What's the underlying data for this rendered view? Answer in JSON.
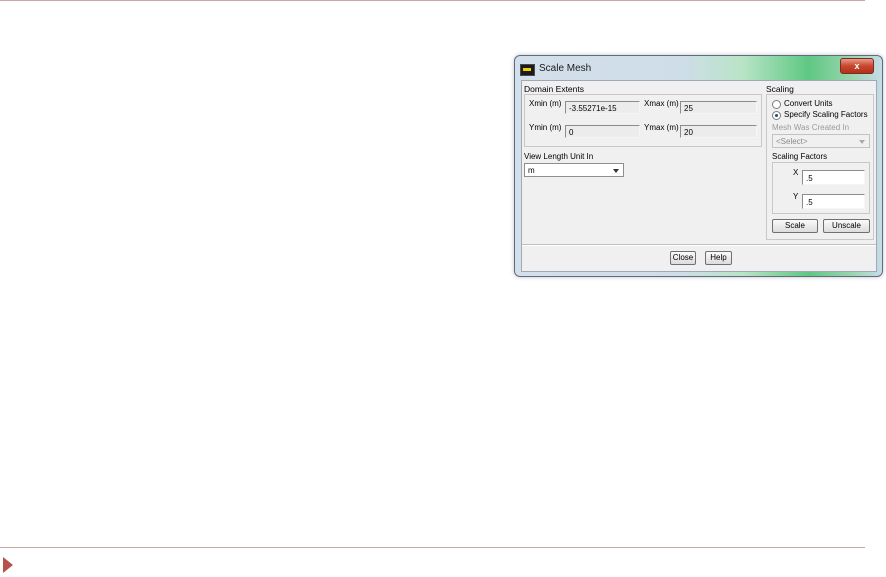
{
  "window": {
    "title": "Scale Mesh",
    "close_label": "x"
  },
  "domain_extents": {
    "title": "Domain Extents",
    "xmin_label": "Xmin (m)",
    "xmin_value": "-3.55271e-15",
    "xmax_label": "Xmax (m)",
    "xmax_value": "25",
    "ymin_label": "Ymin (m)",
    "ymin_value": "0",
    "ymax_label": "Ymax (m)",
    "ymax_value": "20"
  },
  "view_length": {
    "label": "View Length Unit In",
    "selected": "m"
  },
  "scaling": {
    "title": "Scaling",
    "options": [
      {
        "label": "Convert Units",
        "selected": false
      },
      {
        "label": "Specify Scaling Factors",
        "selected": true
      }
    ],
    "mesh_created_label": "Mesh Was Created In",
    "mesh_created_value": "<Select>",
    "factors_title": "Scaling Factors",
    "x_label": "X",
    "x_value": ".5",
    "y_label": "Y",
    "y_value": ".5",
    "scale_button": "Scale",
    "unscale_button": "Unscale"
  },
  "footer": {
    "close_button": "Close",
    "help_button": "Help"
  }
}
